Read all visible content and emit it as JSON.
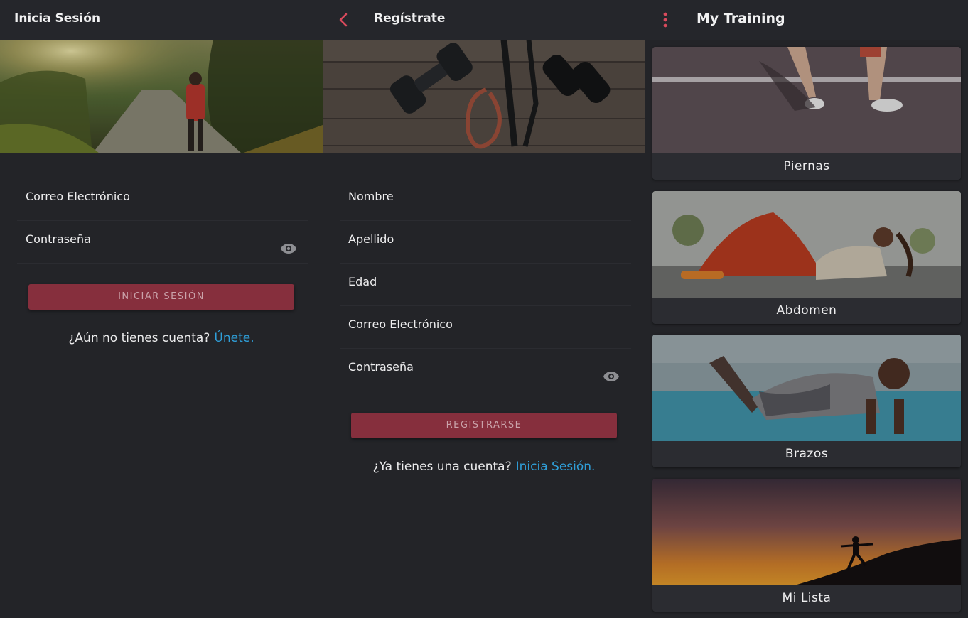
{
  "login": {
    "title": "Inicia Sesión",
    "fields": {
      "email": "Correo Electrónico",
      "password": "Contraseña"
    },
    "submit_label": "INICIAR SESIÓN",
    "footer_question": "¿Aún no tienes cuenta?",
    "footer_link": "Únete."
  },
  "register": {
    "title": "Regístrate",
    "fields": {
      "name": "Nombre",
      "lastname": "Apellido",
      "age": "Edad",
      "email": "Correo Electrónico",
      "password": "Contraseña"
    },
    "submit_label": "REGISTRARSE",
    "footer_question": "¿Ya tienes una cuenta?",
    "footer_link": "Inicia Sesión."
  },
  "training": {
    "title": "My Training",
    "cards": [
      {
        "label": "Piernas"
      },
      {
        "label": "Abdomen"
      },
      {
        "label": "Brazos"
      },
      {
        "label": "Mi Lista"
      }
    ]
  },
  "icons": {
    "back": "chevron-left-icon",
    "menu": "more-vert-icon",
    "visibility": "eye-icon"
  },
  "colors": {
    "background": "#232428",
    "accent": "#d94a5c",
    "button": "#862f3d",
    "link": "#2f9fd9"
  }
}
